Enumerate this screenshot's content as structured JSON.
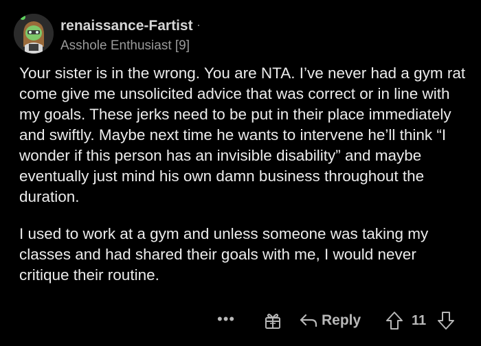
{
  "comment": {
    "author": "renaissance-Fartist",
    "separator": "·",
    "flair": "Asshole Enthusiast [9]",
    "avatar_icon": "snoo-avatar-icon",
    "paragraphs": [
      "Your sister is in the wrong. You are NTA. I’ve never had a gym rat come give me unsolicited advice that was correct or in line with my goals. These jerks need to be put in their place immediately and swiftly. Maybe next time he wants to intervene he’ll think “I wonder if this person has an invisible disability” and maybe eventually just mind his own damn business throughout the duration.",
      "I used to work at a gym and unless someone was taking my classes and had shared their goals with me, I would never critique their routine."
    ]
  },
  "actions": {
    "more_label": "•••",
    "award_icon": "award-icon",
    "reply_icon": "reply-arrow-icon",
    "reply_label": "Reply",
    "upvote_icon": "upvote-arrow-icon",
    "score": "11",
    "downvote_icon": "downvote-arrow-icon"
  },
  "colors": {
    "background": "#000000",
    "text": "#ececec",
    "muted": "#9b9b9b",
    "avatar_accent": "#5fd35f"
  }
}
